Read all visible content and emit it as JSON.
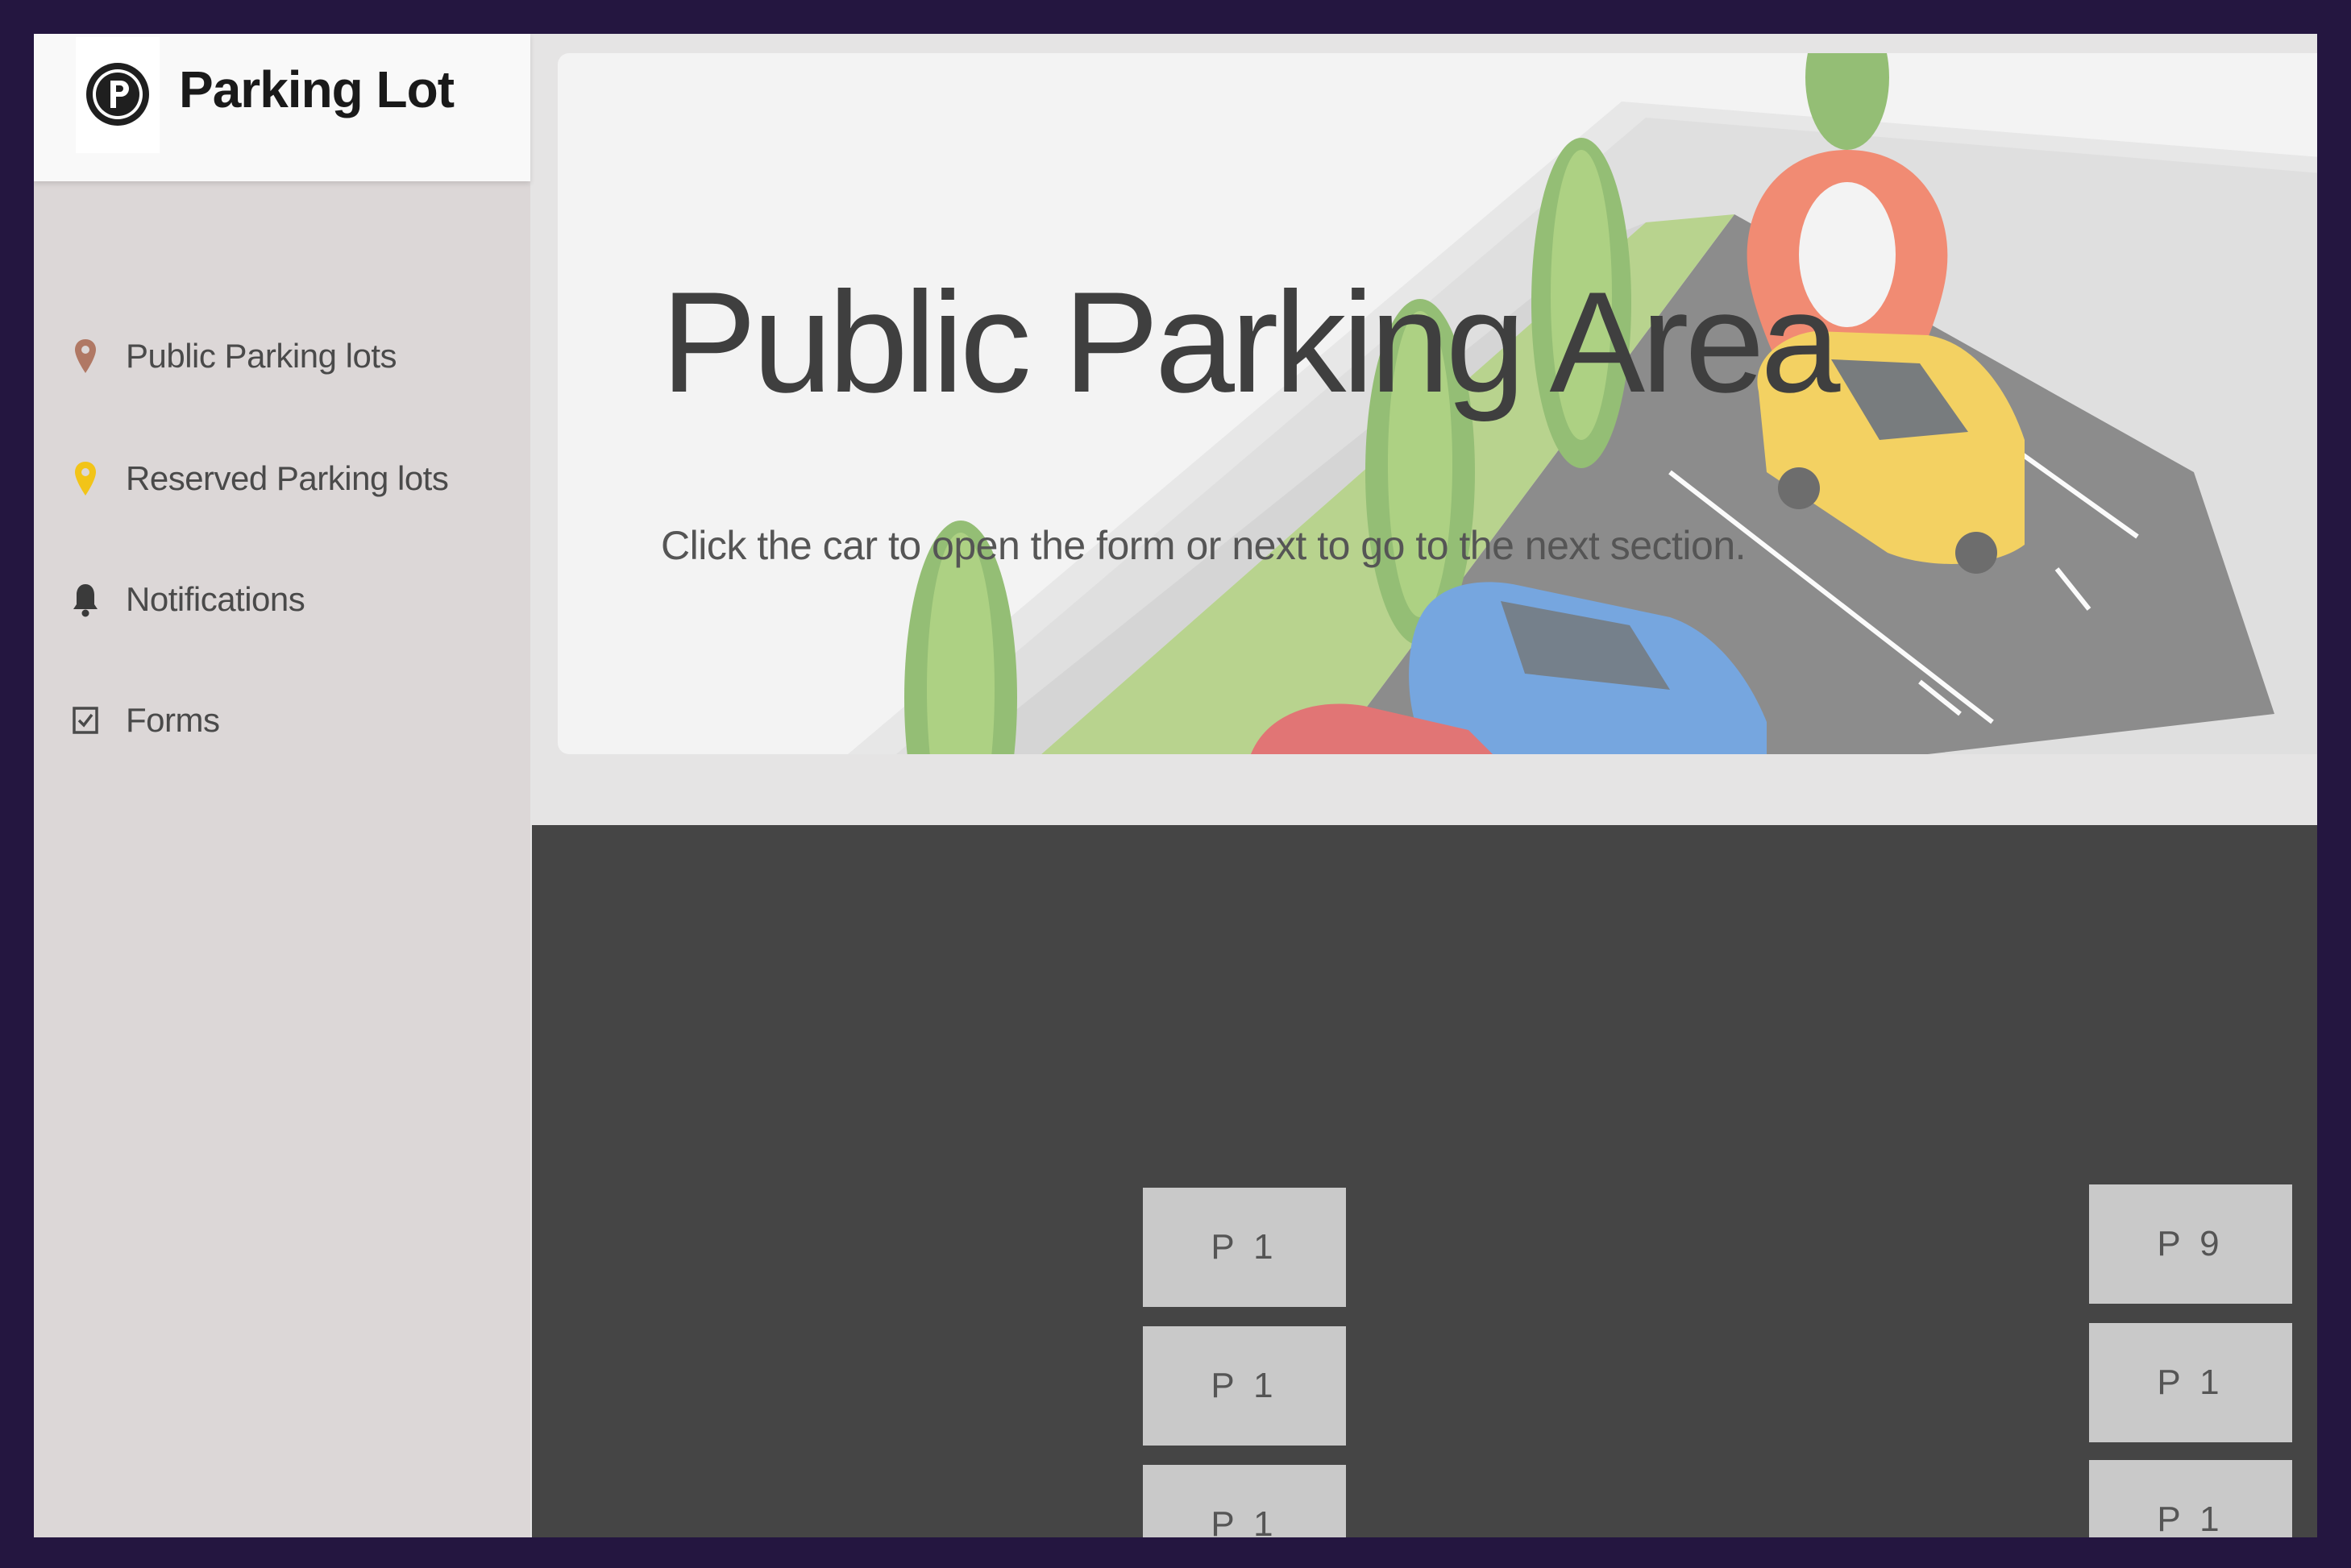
{
  "app": {
    "title": "Parking Lot",
    "logo_icon": "parking-logo-icon"
  },
  "sidebar": {
    "items": [
      {
        "label": "Public Parking lots",
        "icon": "map-pin-icon",
        "icon_color": "#b07864"
      },
      {
        "label": "Reserved Parking lots",
        "icon": "map-pin-icon",
        "icon_color": "#f2c418"
      },
      {
        "label": "Notifications",
        "icon": "bell-icon",
        "icon_color": "#3a3a3a"
      },
      {
        "label": "Forms",
        "icon": "checkbox-icon",
        "icon_color": "#4a4a4a"
      }
    ]
  },
  "hero": {
    "title": "Public Parking Area",
    "subtitle": "Click the car to open the form or next to go to the next section."
  },
  "lot": {
    "left_column": [
      "P 1",
      "P 1",
      "P 1"
    ],
    "right_column": [
      "P 9",
      "P 1",
      "P 1"
    ]
  },
  "colors": {
    "frame_border": "#241640",
    "lot_background": "#454545",
    "slot_background": "#c9c9c9",
    "sidebar_background": "#dcd7d7"
  }
}
